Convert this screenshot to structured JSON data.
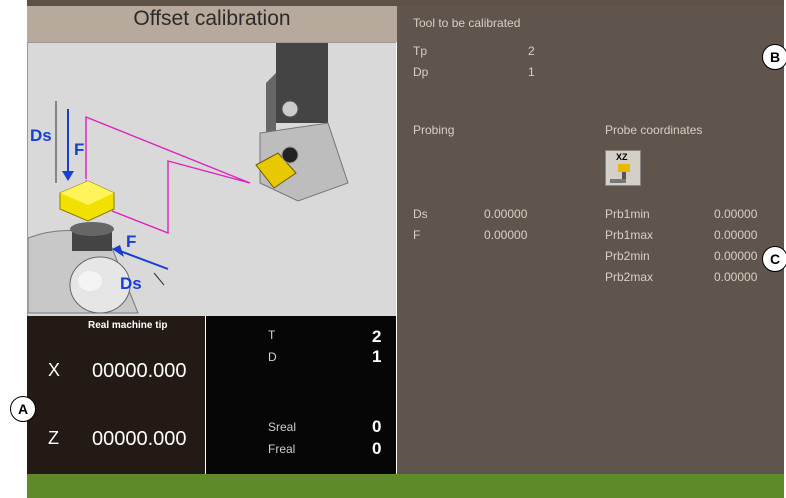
{
  "title": "Offset calibration",
  "tool_section": {
    "heading": "Tool to be calibrated",
    "rows": [
      {
        "label": "Tp",
        "value": "2"
      },
      {
        "label": "Dp",
        "value": "1"
      }
    ]
  },
  "probing": {
    "heading": "Probing",
    "rows": [
      {
        "label": "Ds",
        "value": "0.00000"
      },
      {
        "label": "F",
        "value": "0.00000"
      }
    ]
  },
  "probe_coordinates": {
    "heading": "Probe coordinates",
    "icon_label": "XZ",
    "rows": [
      {
        "label": "Prb1min",
        "value": "0.00000"
      },
      {
        "label": "Prb1max",
        "value": "0.00000"
      },
      {
        "label": "Prb2min",
        "value": "0.00000"
      },
      {
        "label": "Prb2max",
        "value": "0.00000"
      }
    ]
  },
  "real_machine_tip": {
    "heading": "Real machine tip",
    "x_label": "X",
    "x_value": "00000.000",
    "z_label": "Z",
    "z_value": "00000.000"
  },
  "tool_status": {
    "t_label": "T",
    "t_value": "2",
    "d_label": "D",
    "d_value": "1",
    "sreal_label": "Sreal",
    "sreal_value": "0",
    "freal_label": "Freal",
    "freal_value": "0"
  },
  "diagram_labels": {
    "ds_top": "Ds",
    "f_top": "F",
    "f_bottom": "F",
    "ds_bottom": "Ds"
  },
  "callouts": {
    "a": "A",
    "b": "B",
    "c": "C"
  },
  "colors": {
    "right_panel": "#5f554c",
    "title_bar": "#b7a99b",
    "footer": "#5f8a2a",
    "text": "#d9cfc4",
    "path_magenta": "#e020c0",
    "arrow_blue": "#1840d0"
  }
}
